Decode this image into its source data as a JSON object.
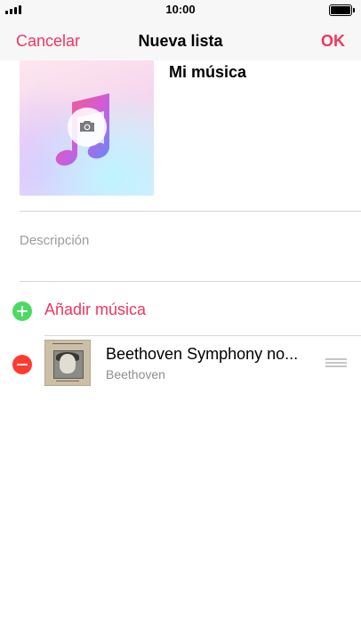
{
  "status_bar": {
    "time": "10:00"
  },
  "nav": {
    "cancel_label": "Cancelar",
    "title": "Nueva lista",
    "done_label": "OK"
  },
  "playlist": {
    "name": "Mi música",
    "artwork_icon": "music-note-icon",
    "camera_icon": "camera-icon"
  },
  "description": {
    "placeholder": "Descripción"
  },
  "add_music": {
    "label": "Añadir música",
    "icon": "plus-circle-icon"
  },
  "songs": [
    {
      "title": "Beethoven Symphony no...",
      "artist": "Beethoven",
      "remove_icon": "minus-circle-icon",
      "reorder_icon": "drag-handle-icon"
    }
  ],
  "colors": {
    "accent": "#f2355f",
    "add_green": "#4cd964",
    "remove_red": "#fe3b30",
    "placeholder_gray": "#9b9ba0",
    "nav_background": "#f7f7f7"
  }
}
